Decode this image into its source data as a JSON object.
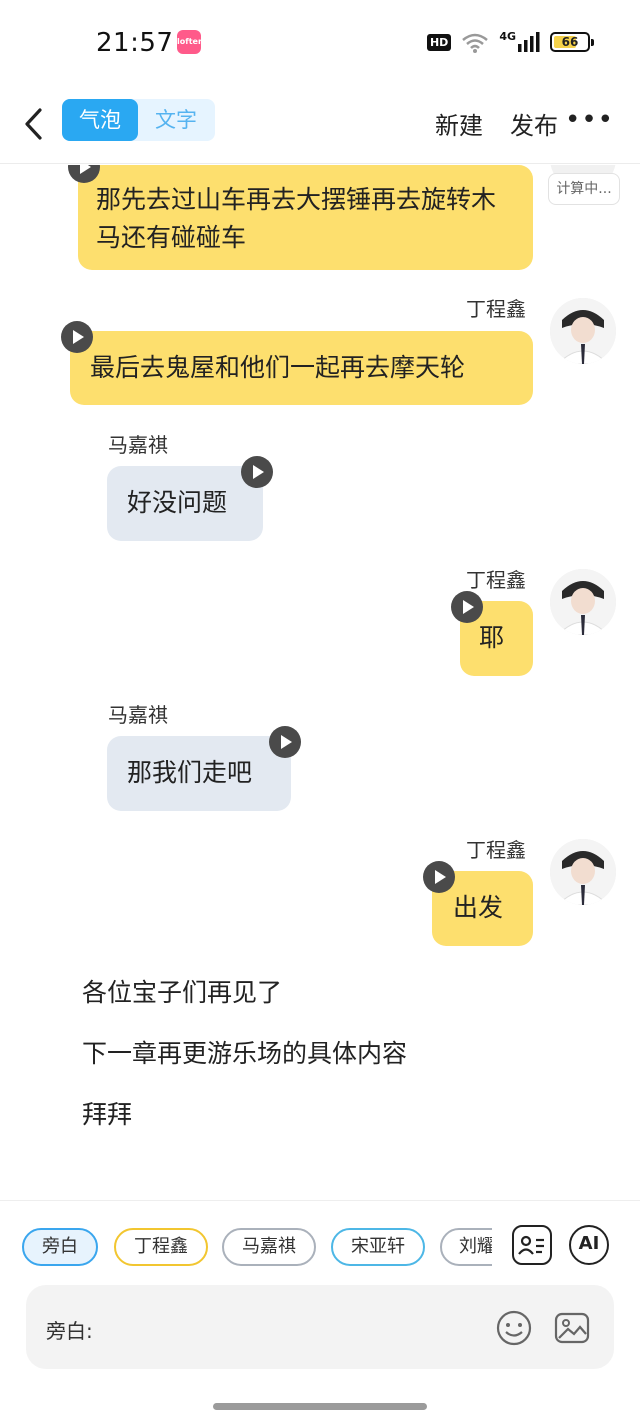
{
  "status_bar": {
    "time": "21:57",
    "app_badge": "lofter",
    "hd": "HD",
    "network": "4G",
    "battery": "66"
  },
  "header": {
    "modes": [
      "气泡",
      "文字"
    ],
    "active_mode": "气泡",
    "new_label": "新建",
    "publish_label": "发布"
  },
  "chat": {
    "status_tag": "计算中...",
    "messages": [
      {
        "speaker": "丁程鑫",
        "side": "right",
        "text": "那先去过山车再去大摆锤再去旋转木马还有碰碰车"
      },
      {
        "speaker": "丁程鑫",
        "side": "right",
        "text": "最后去鬼屋和他们一起再去摩天轮"
      },
      {
        "speaker": "马嘉祺",
        "side": "left",
        "text": "好没问题"
      },
      {
        "speaker": "丁程鑫",
        "side": "right",
        "text": "耶"
      },
      {
        "speaker": "马嘉祺",
        "side": "left",
        "text": "那我们走吧"
      },
      {
        "speaker": "丁程鑫",
        "side": "right",
        "text": "出发"
      }
    ],
    "narration": [
      "各位宝子们再见了",
      "下一章再更游乐场的具体内容",
      "拜拜"
    ]
  },
  "characters": [
    "旁白",
    "丁程鑫",
    "马嘉祺",
    "宋亚轩",
    "刘耀"
  ],
  "selected_character": "旁白",
  "input": {
    "label": "旁白:",
    "ai_label": "AI"
  },
  "colors": {
    "accent": "#2aa8f2",
    "right_bubble": "#fddf6e",
    "left_bubble": "#e3e9f1"
  }
}
